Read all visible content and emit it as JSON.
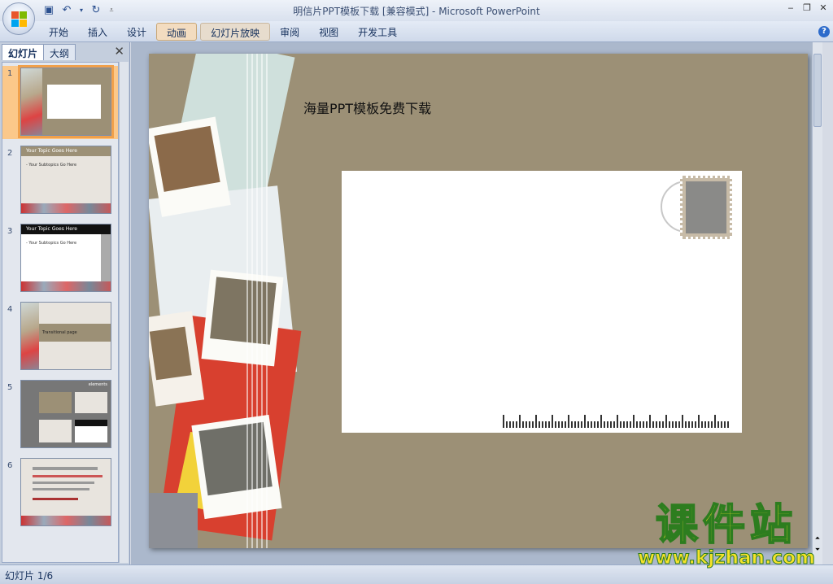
{
  "window": {
    "title": "明信片PPT模板下载 [兼容模式] - Microsoft PowerPoint",
    "controls": [
      "‒",
      "❐",
      "✕"
    ]
  },
  "quick_access": {
    "icons": [
      "save-icon",
      "undo-icon",
      "redo-icon",
      "customize-icon"
    ]
  },
  "ribbon": {
    "tabs": [
      {
        "label": "开始",
        "selected": false
      },
      {
        "label": "插入",
        "selected": false
      },
      {
        "label": "设计",
        "selected": false
      },
      {
        "label": "动画",
        "selected": true
      },
      {
        "label": "幻灯片放映",
        "selected": false
      },
      {
        "label": "审阅",
        "selected": false
      },
      {
        "label": "视图",
        "selected": false
      },
      {
        "label": "开发工具",
        "selected": false
      }
    ],
    "help": "?"
  },
  "left_pane": {
    "tabs": [
      "幻灯片",
      "大纲"
    ],
    "close": "✕",
    "slides": [
      {
        "num": "1",
        "selected": true,
        "title": "",
        "subtitle": ""
      },
      {
        "num": "2",
        "selected": false,
        "title": "Your Topic Goes Here",
        "subtitle": "- Your Subtopics Go Here"
      },
      {
        "num": "3",
        "selected": false,
        "title": "Your Topic Goes Here",
        "subtitle": "- Your Subtopics Go Here"
      },
      {
        "num": "4",
        "selected": false,
        "title": "Transitional  page",
        "subtitle": ""
      },
      {
        "num": "5",
        "selected": false,
        "title": "elements",
        "subtitle": ""
      },
      {
        "num": "6",
        "selected": false,
        "title": "",
        "subtitle": ""
      }
    ]
  },
  "slide": {
    "title": "海量PPT模板免费下载"
  },
  "status": {
    "text": "幻灯片 1/6"
  },
  "watermark": {
    "cn": "课件站",
    "url": "www.kjzhan.com"
  },
  "colors": {
    "slide_bg": "#9c9076",
    "selected_tab": "#f3dcc0",
    "thumb_selected": "#f0a04b"
  }
}
